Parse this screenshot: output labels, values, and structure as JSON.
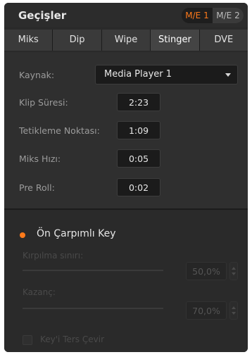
{
  "header": {
    "title": "Geçişler",
    "me_buttons": [
      "M/E 1",
      "M/E 2"
    ]
  },
  "tabs": [
    "Miks",
    "Dip",
    "Wipe",
    "Stinger",
    "DVE"
  ],
  "stinger": {
    "source_label": "Kaynak:",
    "source_value": "Media Player 1",
    "fields": [
      {
        "label": "Klip Süresi:",
        "value": "2:23"
      },
      {
        "label": "Tetikleme Noktası:",
        "value": "1:09"
      },
      {
        "label": "Miks Hızı:",
        "value": "0:05"
      },
      {
        "label": "Pre Roll:",
        "value": "0:02"
      }
    ]
  },
  "key": {
    "label": "Ön Çarpımlı Key",
    "clip_label": "Kırpılma sınırı:",
    "clip_value": "50,0%",
    "gain_label": "Kazanç:",
    "gain_value": "70,0%",
    "invert_label": "Key'i Ters Çevir"
  },
  "colors": {
    "accent": "#ff7a1a",
    "panel": "#2a2a2a"
  }
}
